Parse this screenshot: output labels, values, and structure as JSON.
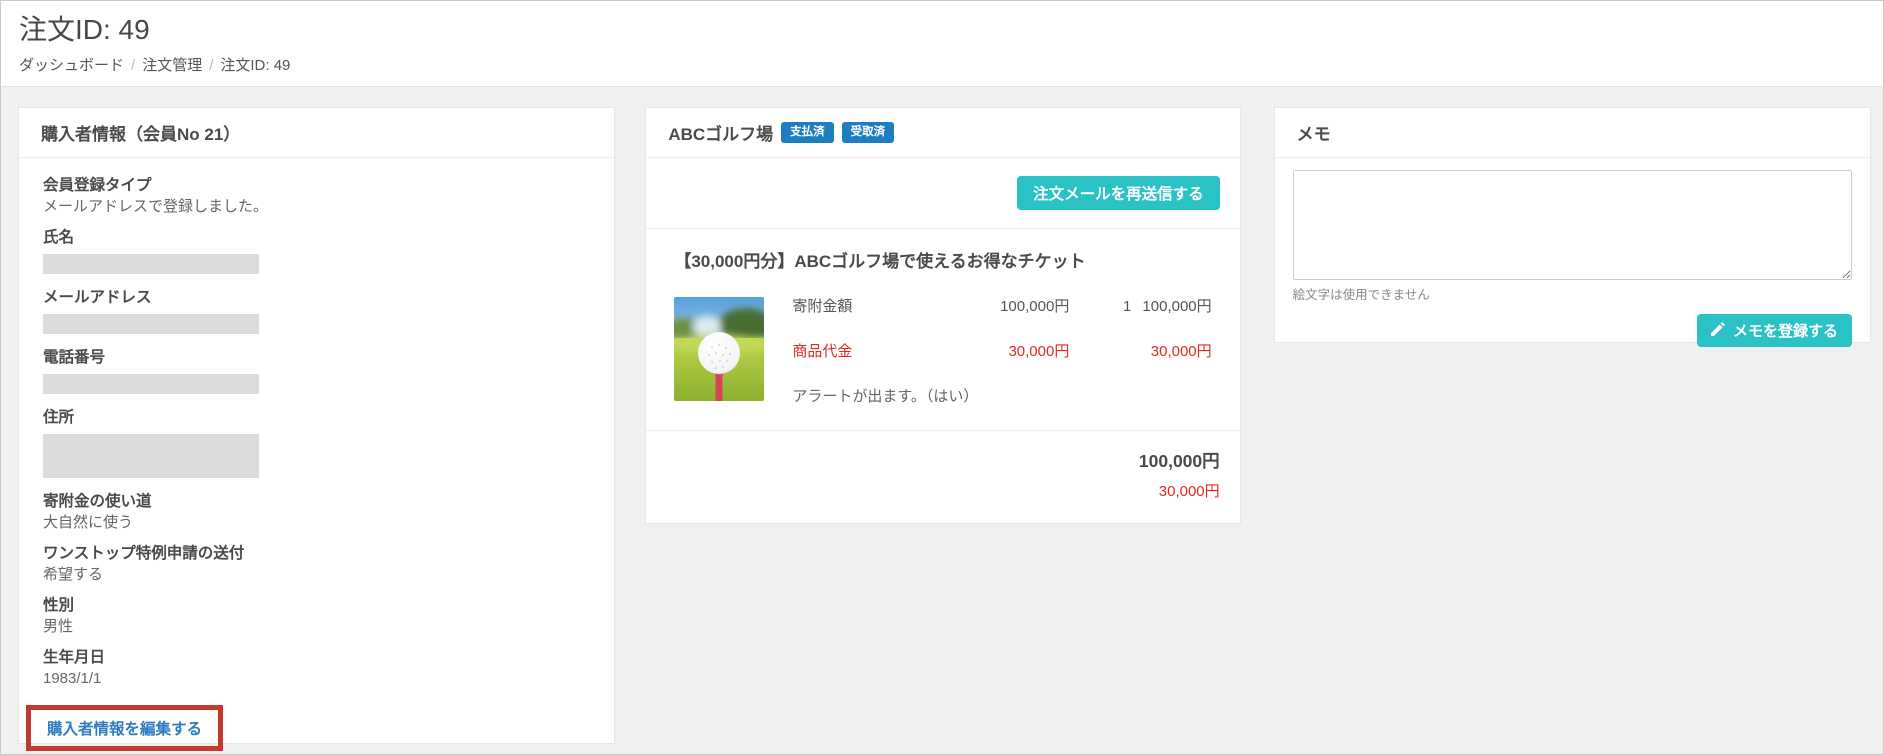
{
  "header": {
    "title": "注文ID: 49",
    "breadcrumb": [
      "ダッシュボード",
      "注文管理",
      "注文ID: 49"
    ],
    "breadcrumb_separator": "/"
  },
  "buyer_panel": {
    "title": "購入者情報（会員No 21）",
    "fields": [
      {
        "label": "会員登録タイプ",
        "value": "メールアドレスで登録しました。"
      },
      {
        "label": "氏名",
        "value": "",
        "redacted": "single"
      },
      {
        "label": "メールアドレス",
        "value": "",
        "redacted": "single"
      },
      {
        "label": "電話番号",
        "value": "",
        "redacted": "single"
      },
      {
        "label": "住所",
        "value": "",
        "redacted": "multi"
      },
      {
        "label": "寄附金の使い道",
        "value": "大自然に使う"
      },
      {
        "label": "ワンストップ特例申請の送付",
        "value": "希望する"
      },
      {
        "label": "性別",
        "value": "男性"
      },
      {
        "label": "生年月日",
        "value": "1983/1/1"
      }
    ],
    "edit_link": "購入者情報を編集する"
  },
  "order_panel": {
    "title": "ABCゴルフ場",
    "badges": [
      "支払済",
      "受取済"
    ],
    "resend_button": "注文メールを再送信する",
    "product": {
      "title": "【30,000円分】ABCゴルフ場で使えるお得なチケット",
      "image": "golf-ball-on-red-tee-photo",
      "rows": [
        {
          "label": "寄附金額",
          "unit_price": "100,000円",
          "quantity": "1",
          "amount": "100,000円"
        },
        {
          "label": "商品代金",
          "unit_price": "30,000円",
          "quantity": "",
          "amount": "30,000円"
        }
      ],
      "note": "アラートが出ます。（はい）"
    },
    "totals": {
      "donation_total": "100,000円",
      "product_total": "30,000円"
    }
  },
  "memo_panel": {
    "title": "メモ",
    "textarea_value": "",
    "textarea_placeholder": "",
    "note": "絵文字は使用できません",
    "submit_button": "メモを登録する",
    "submit_button_icon": "pencil-icon"
  },
  "colors": {
    "accent_teal": "#2bc2c6",
    "badge_blue": "#1e7fc0",
    "price_red": "#e02b20",
    "link_blue": "#2e7cc0",
    "annotation_red": "#c23b2e"
  }
}
